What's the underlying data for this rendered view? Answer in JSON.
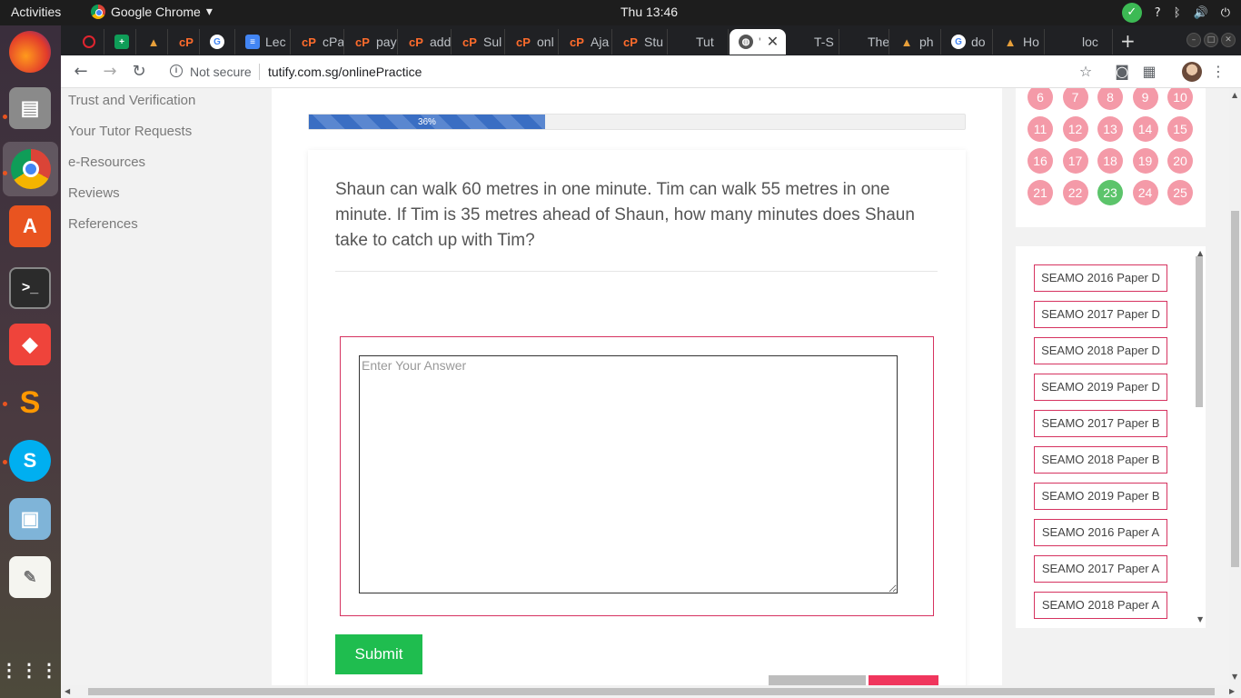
{
  "system": {
    "activities_label": "Activities",
    "app_name": "Google Chrome",
    "clock": "Thu 13:46",
    "tray_question": "?"
  },
  "browser": {
    "tabs": [
      {
        "label": "",
        "icon": "opera-icon"
      },
      {
        "label": "",
        "icon": "sheets-icon"
      },
      {
        "label": "",
        "icon": "cone-icon"
      },
      {
        "label": "",
        "icon": "cpanel-icon"
      },
      {
        "label": "",
        "icon": "google-icon"
      },
      {
        "label": "Lec",
        "icon": "docs-icon"
      },
      {
        "label": "cPa",
        "icon": "cpanel-icon"
      },
      {
        "label": "pay",
        "icon": "cpanel-icon"
      },
      {
        "label": "add",
        "icon": "cpanel-icon"
      },
      {
        "label": "Sul",
        "icon": "cpanel-icon"
      },
      {
        "label": "onl",
        "icon": "cpanel-icon"
      },
      {
        "label": "Aja",
        "icon": "cpanel-icon"
      },
      {
        "label": "Stu",
        "icon": "cpanel-icon"
      },
      {
        "label": "Tut",
        "icon": "blank-icon"
      },
      {
        "label": "T-S",
        "icon": "blank-icon"
      },
      {
        "label": "The",
        "icon": "blank-icon"
      },
      {
        "label": "ph",
        "icon": "cone-icon"
      },
      {
        "label": "do",
        "icon": "google-icon"
      },
      {
        "label": "Ho",
        "icon": "cone-icon"
      },
      {
        "label": "loc",
        "icon": "blank-icon"
      }
    ],
    "not_secure_label": "Not secure",
    "url": "tutify.com.sg/onlinePractice"
  },
  "sidebar": {
    "items": [
      {
        "label": "Trust and Verification"
      },
      {
        "label": "Your Tutor Requests"
      },
      {
        "label": "e-Resources"
      },
      {
        "label": "Reviews"
      },
      {
        "label": "References"
      }
    ]
  },
  "quiz": {
    "progress_label": "36%",
    "progress_value": 0.36,
    "question": "Shaun can walk 60 metres in one minute. Tim can walk 55 metres in one minute. If Tim is 35 metres ahead of Shaun, how many minutes does Shaun take to catch up with Tim?",
    "answer_placeholder": "Enter Your Answer",
    "answer_value": "",
    "submit_label": "Submit"
  },
  "question_nav": {
    "numbers": [
      "6",
      "7",
      "8",
      "9",
      "10",
      "11",
      "12",
      "13",
      "14",
      "15",
      "16",
      "17",
      "18",
      "19",
      "20",
      "21",
      "22",
      "23",
      "24",
      "25"
    ],
    "completed": "23"
  },
  "papers": {
    "items": [
      {
        "label": "SEAMO 2016 Paper D"
      },
      {
        "label": "SEAMO 2017 Paper D"
      },
      {
        "label": "SEAMO 2018 Paper D"
      },
      {
        "label": "SEAMO 2019 Paper D"
      },
      {
        "label": "SEAMO 2017 Paper B"
      },
      {
        "label": "SEAMO 2018 Paper B"
      },
      {
        "label": "SEAMO 2019 Paper B"
      },
      {
        "label": "SEAMO 2016 Paper A"
      },
      {
        "label": "SEAMO 2017 Paper A"
      },
      {
        "label": "SEAMO 2018 Paper A"
      }
    ]
  },
  "colors": {
    "accent_red": "#d63360",
    "submit_green": "#1fbd4f",
    "pending_pink": "#f49aa8",
    "done_green": "#5cc46b",
    "progress_blue": "#3a6ec3"
  }
}
